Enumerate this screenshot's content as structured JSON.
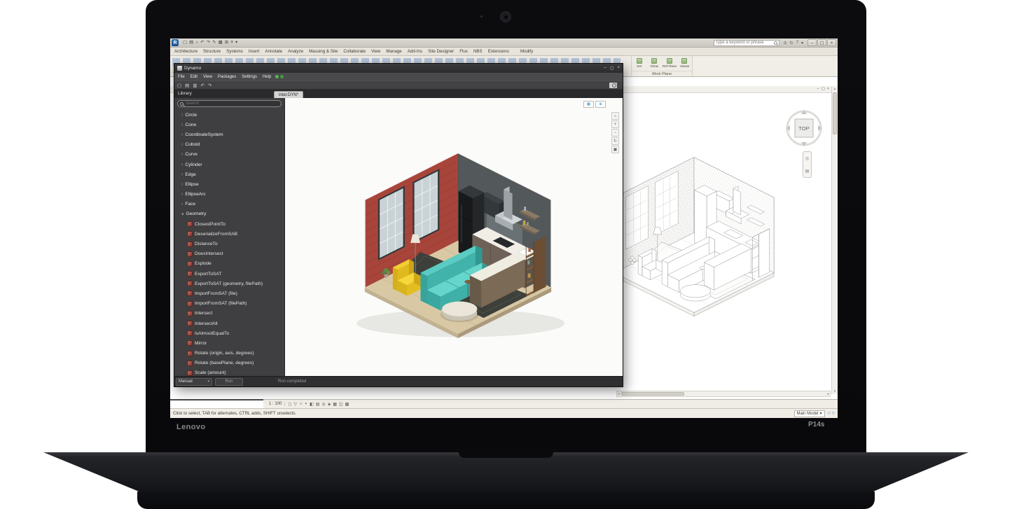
{
  "laptop": {
    "brand": "Lenovo",
    "model": "P14s"
  },
  "revit": {
    "titlebar": {
      "app_initial": "R",
      "qat_icons": [
        "▢",
        "▤",
        "⌂",
        "↶",
        "↷",
        "✎",
        "▦",
        "⊞",
        "≡",
        "▾"
      ],
      "search_placeholder": "Type a keyword or phrase",
      "account_icons": [
        "⊙",
        "↻",
        "?",
        "▾"
      ],
      "window_buttons": [
        "–",
        "▢",
        "×"
      ]
    },
    "ribbon_tabs": [
      "Architecture",
      "Structure",
      "Systems",
      "Insert",
      "Annotate",
      "Analyze",
      "Massing & Site",
      "Collaborate",
      "View",
      "Manage",
      "Add-Ins",
      "Site Designer",
      "Flux",
      "NBS",
      "Extensions",
      "Modify"
    ],
    "active_tab": "Architecture",
    "work_plane_panel": {
      "buttons": [
        "Set",
        "Show",
        "Ref Plane",
        "Viewer"
      ],
      "label": "Work Plane"
    },
    "view_window_buttons": [
      "–",
      "▢",
      "×"
    ],
    "viewcube_label": "TOP",
    "nav_bar_icons": [
      "◎",
      "▤"
    ],
    "view_bar": {
      "scale": "1 : 100",
      "icons": [
        "◻",
        "▽",
        "☼",
        "◐",
        "◧",
        "▤",
        "◎",
        "◈",
        "▦",
        "◫",
        "▩"
      ]
    },
    "status_bar": {
      "hint": "Click to select, TAB for alternates, CTRL adds, SHIFT unselects.",
      "design_option": "Main Model",
      "filter_icons": [
        "▽",
        "▽"
      ]
    },
    "scrollbar_arrows": {
      "up": "▴",
      "down": "▾",
      "left": "◂",
      "right": "▸"
    }
  },
  "dynamo": {
    "title": "Dynamo",
    "window_buttons": [
      "–",
      "▢",
      "×"
    ],
    "menus": [
      "File",
      "Edit",
      "View",
      "Packages",
      "Settings",
      "Help"
    ],
    "toolbar_icons": [
      "▢",
      "▤",
      "▥",
      "↶",
      "↷"
    ],
    "workspace_tab": "inter.DYN*",
    "library": {
      "title": "Library",
      "search_placeholder": "Search",
      "categories": [
        "Circle",
        "Cone",
        "CoordinateSystem",
        "Cuboid",
        "Curve",
        "Cylinder",
        "Edge",
        "Ellipse",
        "EllipseArc",
        "Face"
      ],
      "expanded_category": "Geometry",
      "members": [
        "ClosestPointTo",
        "DeserializeFromSAB",
        "DistanceTo",
        "DoesIntersect",
        "Explode",
        "ExportToSAT",
        "ExportToSAT (geometry, filePath)",
        "ImportFromSAT (file)",
        "ImportFromSAT (filePath)",
        "Intersect",
        "IntersectAll",
        "IsAlmostEqualTo",
        "Mirror",
        "Rotate (origin, axis, degrees)",
        "Rotate (basePlane, degrees)",
        "Scale (amount)"
      ]
    },
    "preview_buttons": [
      "▦",
      "⊕"
    ],
    "canvas_nav_icons": [
      "⌂",
      "+",
      "−",
      "↻",
      "▣"
    ],
    "run_bar": {
      "mode": "Manual",
      "run_label": "Run",
      "status": "Run completed"
    }
  }
}
